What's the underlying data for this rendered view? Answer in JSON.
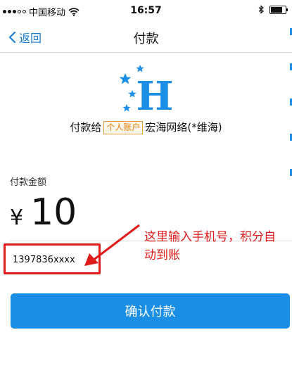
{
  "status_bar": {
    "carrier": "中国移动",
    "time": "16:57",
    "signal_bars": 5,
    "signal_filled": 3,
    "battery_level": 0.8
  },
  "nav": {
    "back_label": "返回",
    "title": "付款"
  },
  "payee": {
    "prefix": "付款给",
    "badge": "个人账户",
    "name": "宏海网络(*维海)"
  },
  "logo": {
    "letter": "H"
  },
  "amount": {
    "label": "付款金额",
    "currency": "¥",
    "value": "10"
  },
  "phone": {
    "value": "1397836xxxx"
  },
  "annotation": {
    "text": "这里输入手机号，积分自动到账"
  },
  "confirm": {
    "label": "确认付款"
  },
  "colors": {
    "accent": "#1b8fe6",
    "link": "#1a7fd6",
    "annotation": "#e01b1b",
    "badge": "#e07f12"
  }
}
